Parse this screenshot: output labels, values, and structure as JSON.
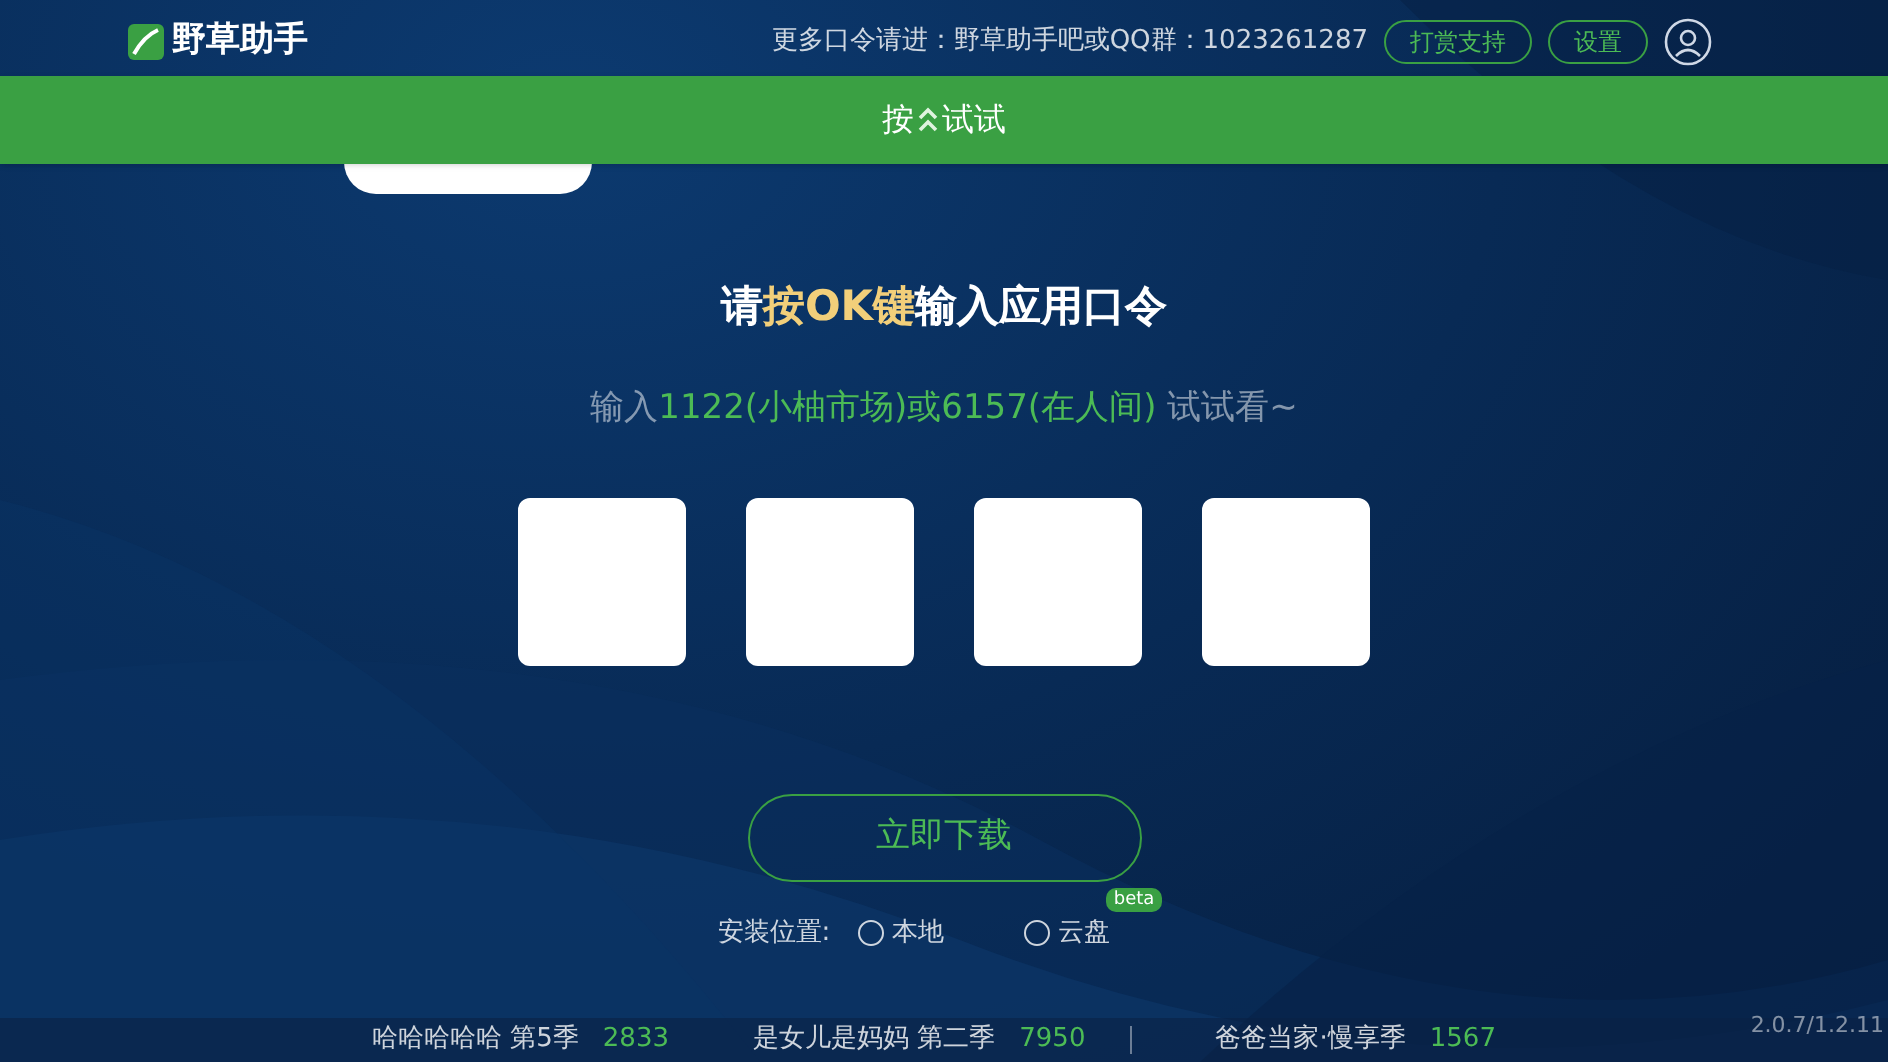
{
  "header": {
    "app_name": "野草助手",
    "notice": "更多口令请进：野草助手吧或QQ群：1023261287",
    "buttons": [
      "打赏支持",
      "设置"
    ]
  },
  "tabs": [
    {
      "selected": true
    }
  ],
  "toast": {
    "before": "按",
    "after": "试试"
  },
  "title": [
    {
      "text": "请",
      "kind": "plain"
    },
    {
      "text": "按OK键",
      "kind": "highlight"
    },
    {
      "text": "输入应用口令",
      "kind": "plain"
    }
  ],
  "hint": [
    {
      "text": "输入",
      "kind": "plain"
    },
    {
      "text": "1122(小柚市场)或6157(在人间)",
      "kind": "highlight"
    },
    {
      "text": " 试试看~",
      "kind": "plain"
    }
  ],
  "download_button": "立即下载",
  "install_location": {
    "label": "安装位置:",
    "options": [
      {
        "label": "本地",
        "selected": false
      },
      {
        "label": "云盘",
        "selected": false,
        "badge": "beta"
      }
    ]
  },
  "bottom_items": [
    {
      "title": "哈哈哈哈哈 第5季",
      "count": "2833"
    },
    {
      "title": "是女儿是妈妈 第二季",
      "count": "7950"
    },
    {
      "title": "爸爸当家·慢享季",
      "count": "1567"
    }
  ],
  "version": "2.0.7/1.2.11"
}
